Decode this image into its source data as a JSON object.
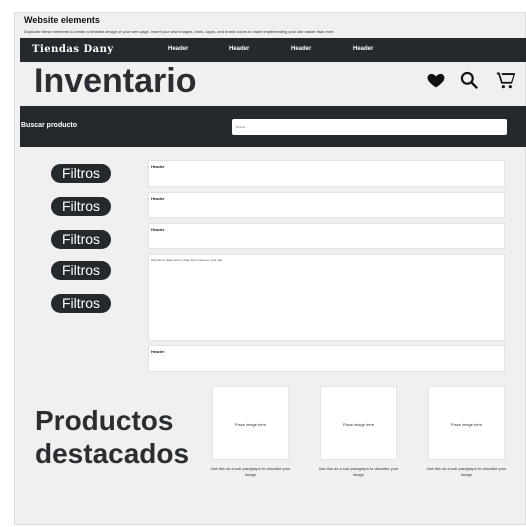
{
  "frame": {
    "title": "Website elements",
    "description": "Duplicate these elements to create a detailed design of your web page. Insert your own images, fonts, logos, and brand colors to make implementing your site easier than ever."
  },
  "header": {
    "brand": "Tiendas Dany",
    "nav": [
      "Header",
      "Header",
      "Header",
      "Header"
    ]
  },
  "page": {
    "title": "Inventario",
    "icons": [
      "heart-icon",
      "search-icon",
      "cart-icon"
    ]
  },
  "search": {
    "label": "Buscar producto",
    "placeholder": "Buscar"
  },
  "filters": [
    "Filtros",
    "Filtros",
    "Filtros",
    "Filtros",
    "Filtros"
  ],
  "panels": [
    {
      "title": "Header"
    },
    {
      "title": "Header"
    },
    {
      "title": "Header"
    },
    {
      "note": "Use this to place text or drop-down menu on your site"
    },
    {
      "title": "Header"
    }
  ],
  "featured": {
    "title_line1": "Productos",
    "title_line2": "destacados",
    "products": [
      {
        "image_label": "Place image here",
        "caption": "Use this as a sub-paragraph to describe your image"
      },
      {
        "image_label": "Place image here",
        "caption": "Use this as a sub-paragraph to describe your image"
      },
      {
        "image_label": "Place image here",
        "caption": "Use this as a sub-paragraph to describe your image"
      }
    ]
  },
  "colors": {
    "dark": "#24292e",
    "canvas": "#f0f0f0",
    "card": "#ffffff"
  }
}
